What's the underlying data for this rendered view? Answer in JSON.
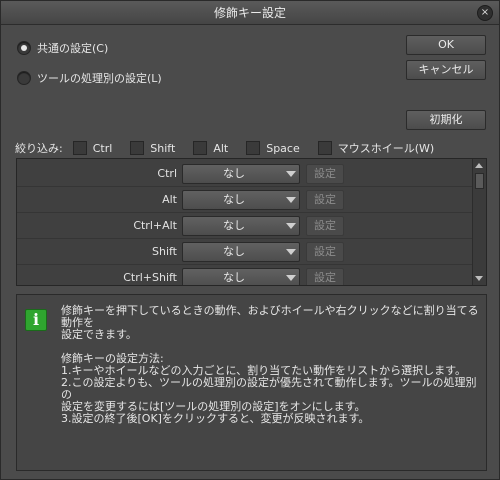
{
  "window": {
    "title": "修飾キー設定",
    "close_glyph": "×"
  },
  "radios": [
    {
      "label": "共通の設定(C)",
      "selected": true
    },
    {
      "label": "ツールの処理別の設定(L)",
      "selected": false
    }
  ],
  "buttons": {
    "ok": "OK",
    "cancel": "キャンセル",
    "reset": "初期化"
  },
  "filter": {
    "label": "絞り込み:",
    "options": [
      "Ctrl",
      "Shift",
      "Alt",
      "Space",
      "マウスホイール(W)"
    ]
  },
  "modifier_list": [
    {
      "key": "Ctrl",
      "value": "なし",
      "button": "設定"
    },
    {
      "key": "Alt",
      "value": "なし",
      "button": "設定"
    },
    {
      "key": "Ctrl+Alt",
      "value": "なし",
      "button": "設定"
    },
    {
      "key": "Shift",
      "value": "なし",
      "button": "設定"
    },
    {
      "key": "Ctrl+Shift",
      "value": "なし",
      "button": "設定"
    }
  ],
  "info": {
    "line1": "修飾キーを押下しているときの動作、およびホイールや右クリックなどに割り当てる動作を",
    "line2": "設定できます。",
    "heading": "修飾キーの設定方法:",
    "step1": "1.キーやホイールなどの入力ごとに、割り当てたい動作をリストから選択します。",
    "step2a": "2.この設定よりも、ツールの処理別の設定が優先されて動作します。ツールの処理別の",
    "step2b": "設定を変更するには[ツールの処理別の設定]をオンにします。",
    "step3": "3.設定の終了後[OK]をクリックすると、変更が反映されます。"
  },
  "colors": {
    "info_icon": "#2fa52f",
    "background": "#4b4b4b"
  }
}
